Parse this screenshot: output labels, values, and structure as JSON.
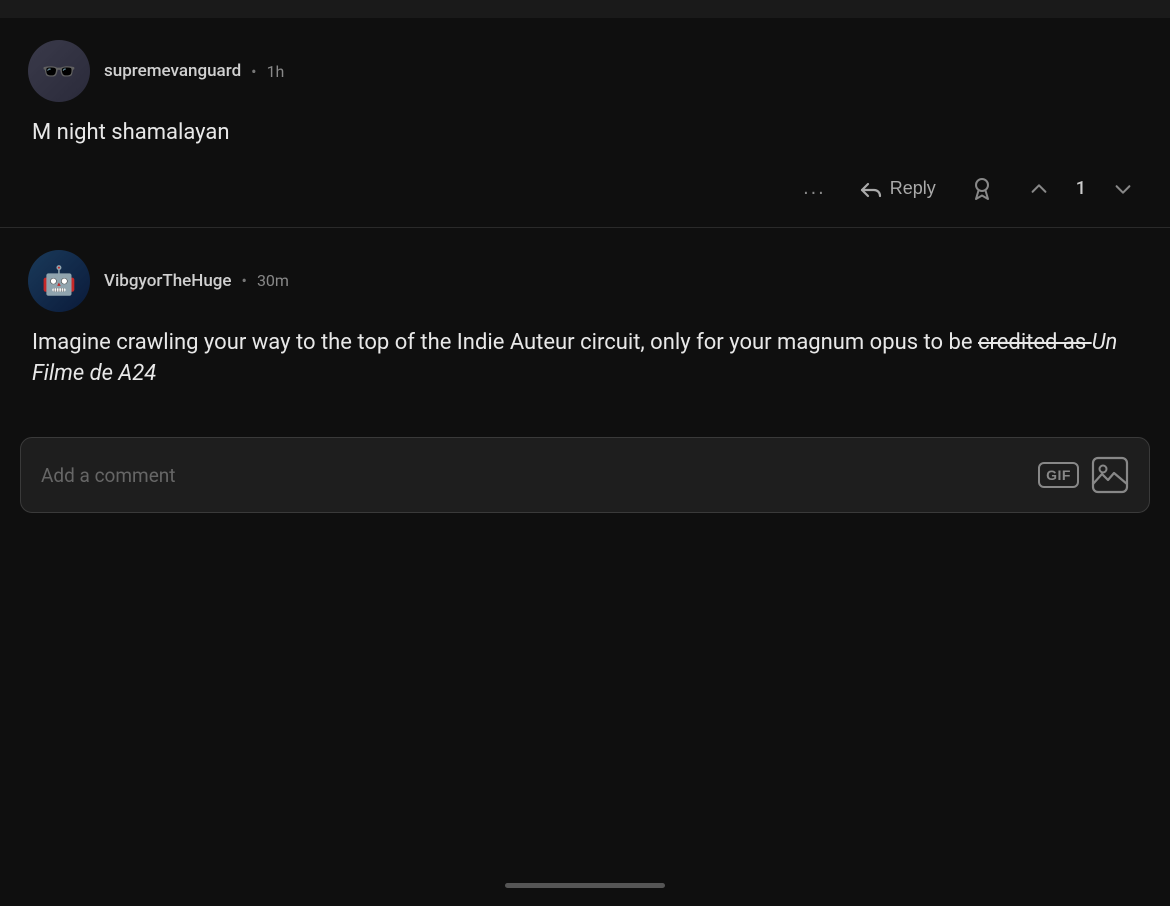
{
  "topBar": {
    "height": 18
  },
  "comments": [
    {
      "id": "comment1",
      "username": "supremevanguard",
      "timestamp": "1h",
      "text": "M night shamalayan",
      "actions": {
        "dots": "...",
        "reply": "Reply",
        "upvote": "1",
        "downvote": ""
      }
    },
    {
      "id": "comment2",
      "username": "VibgyorTheHuge",
      "timestamp": "30m",
      "text": "Imagine crawling your way to the top of the Indie Auteur circuit, only for your magnum opus to be credited as ",
      "textItalic": "Un Filme de A24",
      "textStrikethrough": "credited as "
    }
  ],
  "commentInput": {
    "placeholder": "Add a comment",
    "gifLabel": "GIF",
    "imageLabel": "image"
  },
  "bottomBar": {
    "indicator": ""
  }
}
